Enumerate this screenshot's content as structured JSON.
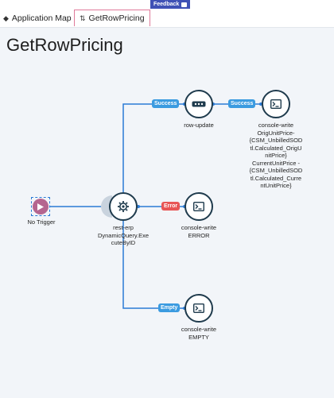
{
  "feedback": {
    "label": "Feedback"
  },
  "tabs": [
    {
      "label": "Application Map"
    },
    {
      "label": "GetRowPricing"
    }
  ],
  "page": {
    "title": "GetRowPricing"
  },
  "nodes": {
    "trigger": {
      "label": "No Trigger"
    },
    "rest_erp": {
      "label_1": "rest-erp",
      "label_2": "DynamicQuery.Exe",
      "label_3": "cuteByID"
    },
    "row_update": {
      "label": "row-update"
    },
    "console_success": {
      "lines": [
        "console-write",
        "OrigUnitPrice-",
        "{CSM_UnbilledSOD",
        "tl.Calculated_OrigU",
        "nitPrice}",
        "CurrentUnitPrice -",
        "{CSM_UnbilledSOD",
        "tl.Calculated_Curre",
        "ntUnitPrice}"
      ]
    },
    "console_error": {
      "lines": [
        "console-write",
        "ERROR"
      ]
    },
    "console_empty": {
      "lines": [
        "console-write",
        "EMPTY"
      ]
    }
  },
  "badges": {
    "success_1": "Success",
    "success_2": "Success",
    "error": "Error",
    "empty": "Empty"
  },
  "colors": {
    "line": "#2b7bd6",
    "node_border": "#1f3b4d",
    "trigger": "#b5658f",
    "error": "#e85656",
    "success": "#3b9be0"
  }
}
